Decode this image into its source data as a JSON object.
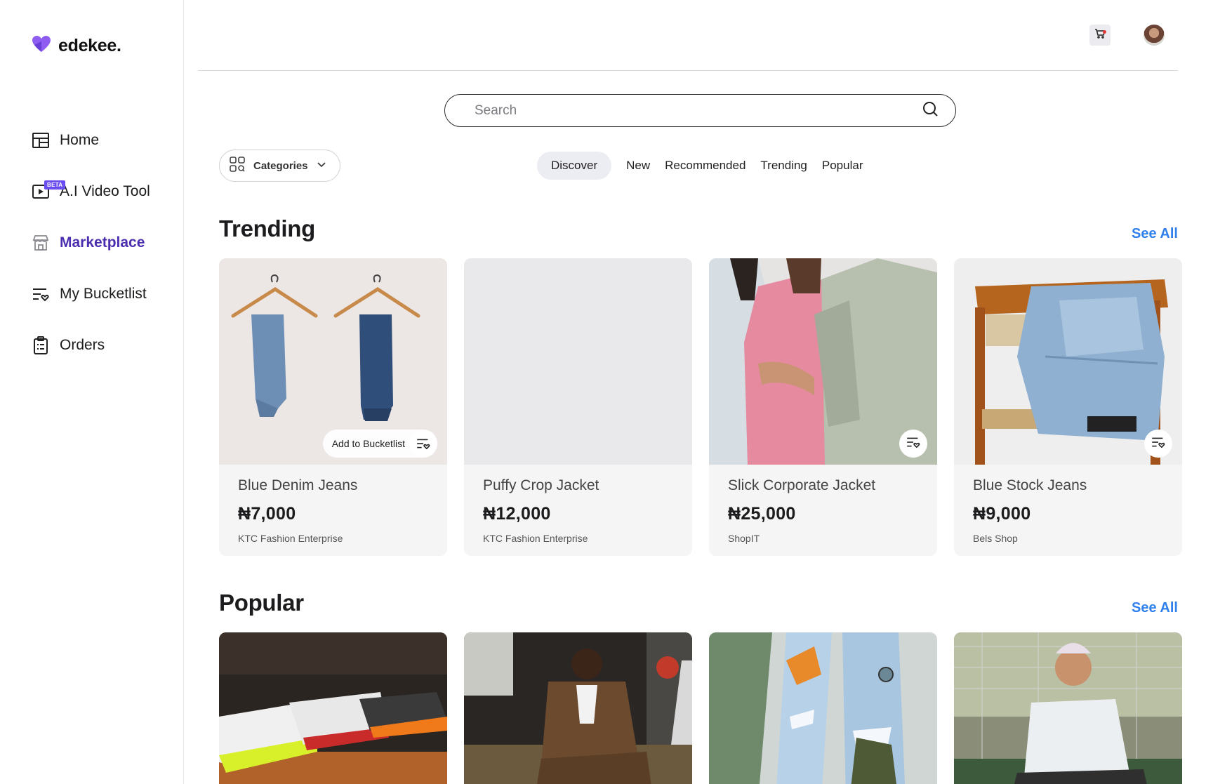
{
  "brand": {
    "name": "edekee."
  },
  "sidebar": {
    "items": [
      {
        "label": "Home",
        "icon": "layout-icon",
        "active": false
      },
      {
        "label": "A.I Video Tool",
        "icon": "video-icon",
        "badge": "BETA",
        "active": false
      },
      {
        "label": "Marketplace",
        "icon": "store-icon",
        "active": true
      },
      {
        "label": "My Bucketlist",
        "icon": "bucketlist-icon",
        "active": false
      },
      {
        "label": "Orders",
        "icon": "clipboard-icon",
        "active": false
      }
    ]
  },
  "search": {
    "placeholder": "Search",
    "value": ""
  },
  "filters": {
    "categories_label": "Categories",
    "tabs": [
      "Discover",
      "New",
      "Recommended",
      "Trending",
      "Popular"
    ],
    "active_tab": "Discover"
  },
  "sections": {
    "trending": {
      "title": "Trending",
      "see_all": "See All",
      "products": [
        {
          "name": "Blue Denim Jeans",
          "price": "₦7,000",
          "seller": "KTC Fashion Enterprise",
          "bucket_label": "Add to Bucketlist"
        },
        {
          "name": "Puffy Crop Jacket",
          "price": "₦12,000",
          "seller": "KTC Fashion Enterprise"
        },
        {
          "name": "Slick Corporate Jacket",
          "price": "₦25,000",
          "seller": "ShopIT"
        },
        {
          "name": "Blue Stock Jeans",
          "price": "₦9,000",
          "seller": "Bels Shop"
        }
      ]
    },
    "popular": {
      "title": "Popular",
      "see_all": "See All"
    }
  },
  "colors": {
    "accent": "#4b2fb0",
    "link": "#2f80ed",
    "brand_heart": "#8e5cf0"
  }
}
